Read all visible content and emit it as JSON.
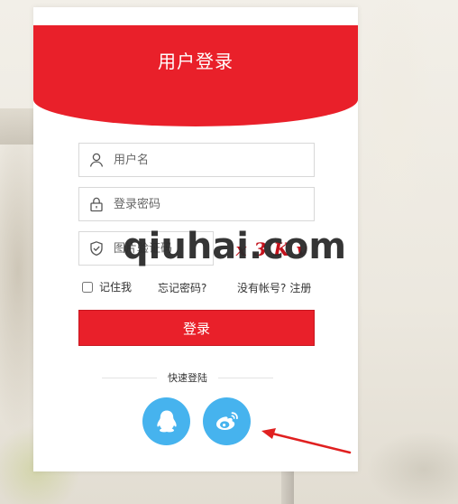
{
  "header": {
    "title": "用户登录"
  },
  "form": {
    "username_placeholder": "用户名",
    "password_placeholder": "登录密码",
    "captcha_placeholder": "图片验证码",
    "captcha_text": "x3Kv"
  },
  "options": {
    "remember_label": "记住我",
    "forgot_label": "忘记密码?",
    "no_account_label": "没有帐号?",
    "register_label": "注册"
  },
  "login_button": {
    "label": "登录"
  },
  "quick_login": {
    "label": "快速登陆",
    "providers": [
      "qq-icon",
      "weibo-icon"
    ]
  },
  "watermark": {
    "text": "qiuhai.com"
  },
  "colors": {
    "brand_red": "#e9202a",
    "social_blue": "#46b3ee",
    "arrow_red": "#e02020"
  }
}
